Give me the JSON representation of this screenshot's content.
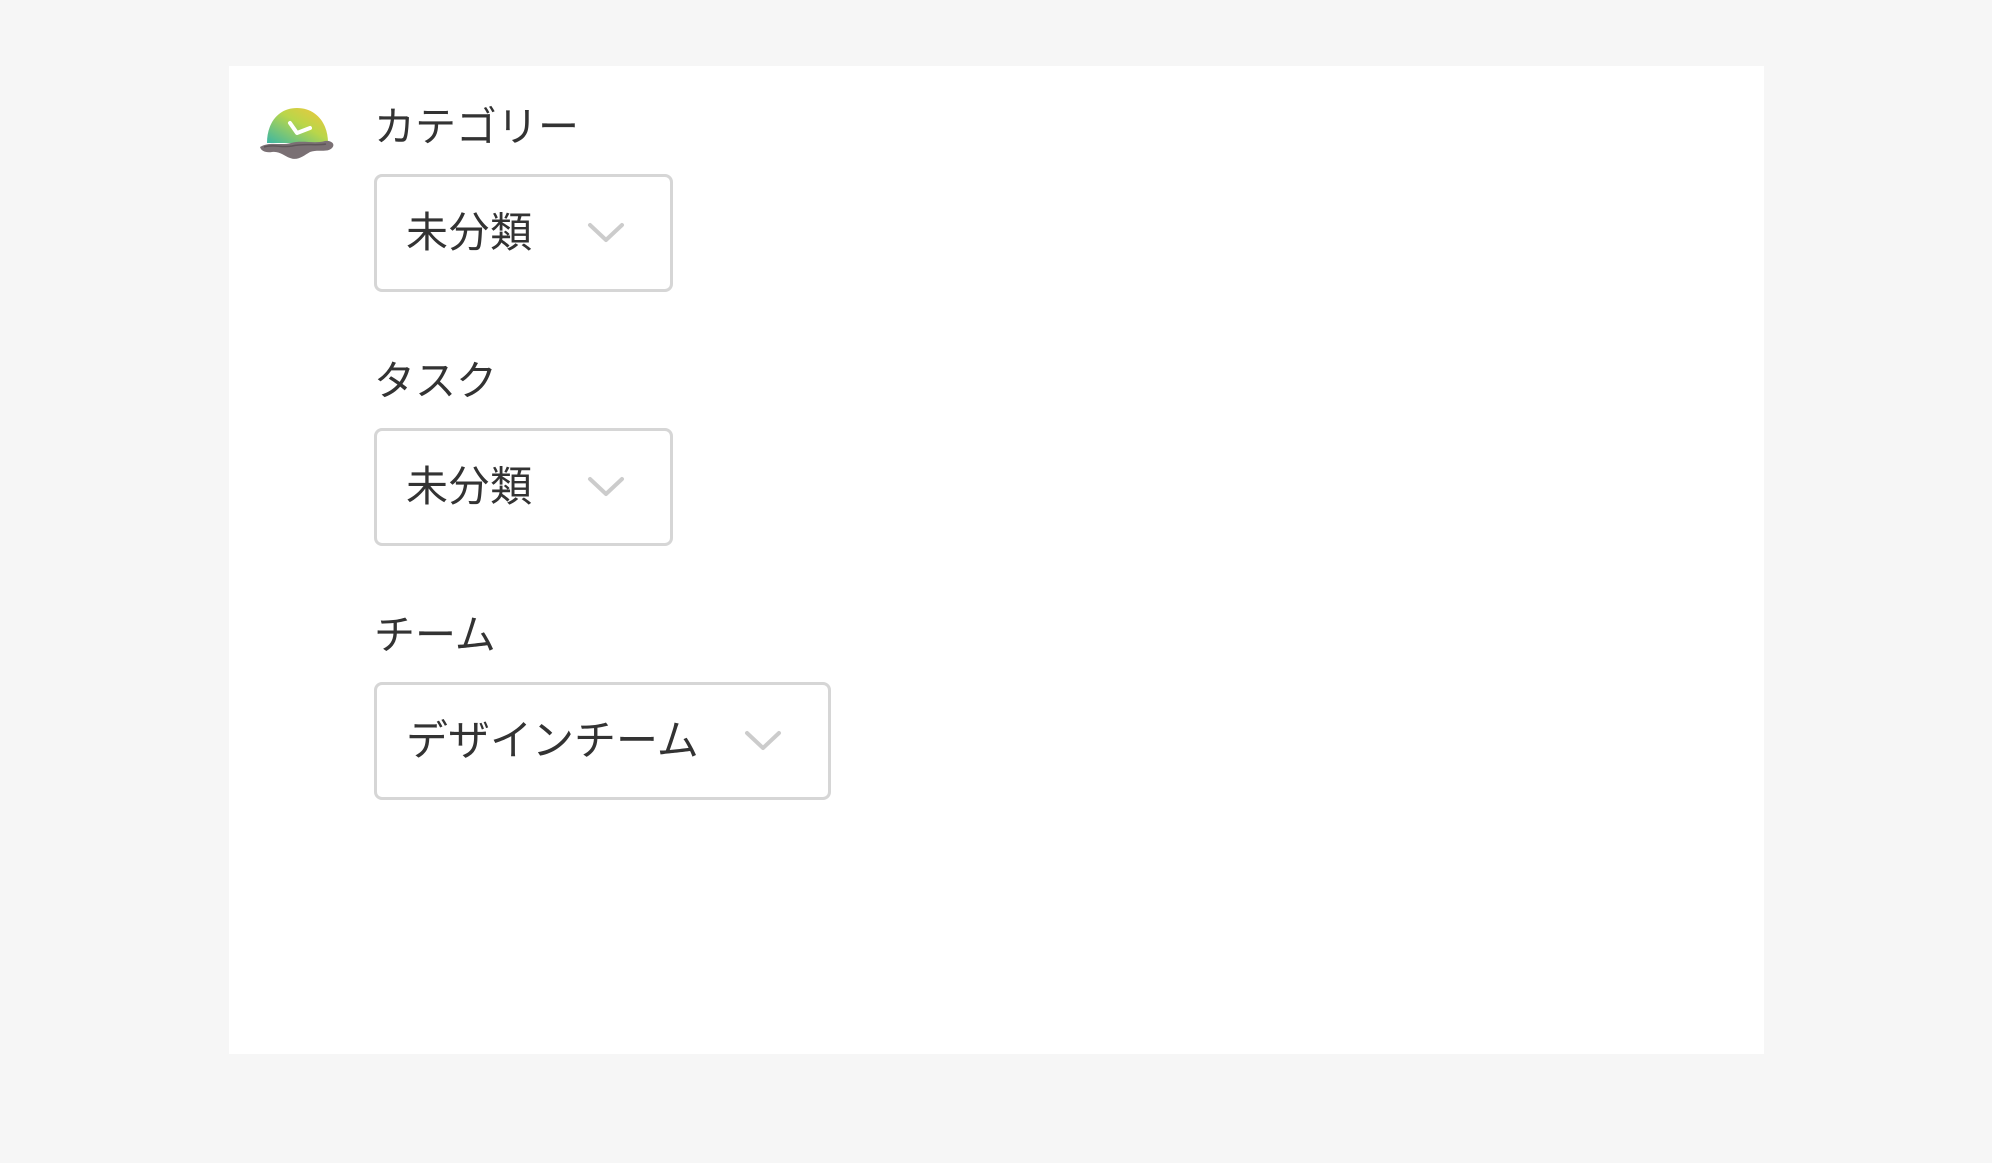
{
  "icons": {
    "app_logo": "clock-logo-icon",
    "dropdown": "chevron-down-icon"
  },
  "colors": {
    "background": "#f6f6f6",
    "panel": "#ffffff",
    "text": "#333333",
    "border": "#d6d6d6",
    "chevron": "#cccccc"
  },
  "form": {
    "category": {
      "label": "カテゴリー",
      "value": "未分類"
    },
    "task": {
      "label": "タスク",
      "value": "未分類"
    },
    "team": {
      "label": "チーム",
      "value": "デザインチーム"
    }
  }
}
